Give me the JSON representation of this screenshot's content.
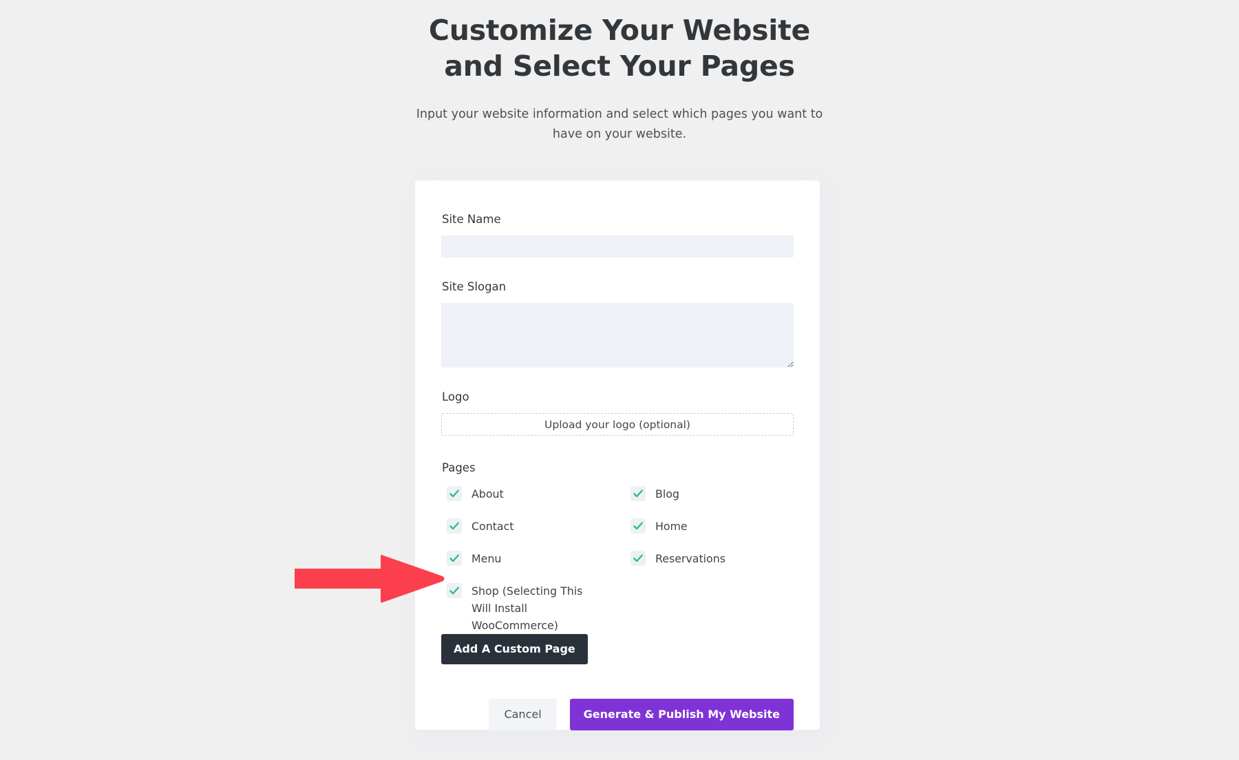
{
  "header": {
    "title": "Customize Your Website and Select Your Pages",
    "subtitle": "Input your website information and select which pages you want to have on your website."
  },
  "form": {
    "site_name": {
      "label": "Site Name",
      "value": "",
      "placeholder": ""
    },
    "site_slogan": {
      "label": "Site Slogan",
      "value": "",
      "placeholder": ""
    },
    "logo": {
      "label": "Logo",
      "upload_text": "Upload your logo (optional)"
    },
    "pages": {
      "label": "Pages",
      "options": [
        {
          "label": "About",
          "checked": true
        },
        {
          "label": "Blog",
          "checked": true
        },
        {
          "label": "Contact",
          "checked": true
        },
        {
          "label": "Home",
          "checked": true
        },
        {
          "label": "Menu",
          "checked": true
        },
        {
          "label": "Reservations",
          "checked": true
        },
        {
          "label": "Shop (Selecting This Will Install WooCommerce)",
          "checked": true
        }
      ]
    },
    "add_custom_page_label": "Add A Custom Page"
  },
  "actions": {
    "cancel_label": "Cancel",
    "publish_label": "Generate & Publish My Website"
  },
  "annotation": {
    "arrow_icon": "right-arrow-icon",
    "arrow_color": "#fb3f4d",
    "points_to": "Shop (Selecting This Will Install WooCommerce)"
  },
  "colors": {
    "page_background": "#f0f0f0",
    "card_background": "#ffffff",
    "input_background": "#eef2f6",
    "checkbox_background": "#eef0f5",
    "checkmark": "#1fc08a",
    "dark_button": "#2b313b",
    "primary_button": "#7f33d6",
    "cancel_button": "#f2f4f7",
    "annotation_red": "#fb3f4d",
    "heading_text": "#32373c",
    "body_text": "#3c434a"
  }
}
